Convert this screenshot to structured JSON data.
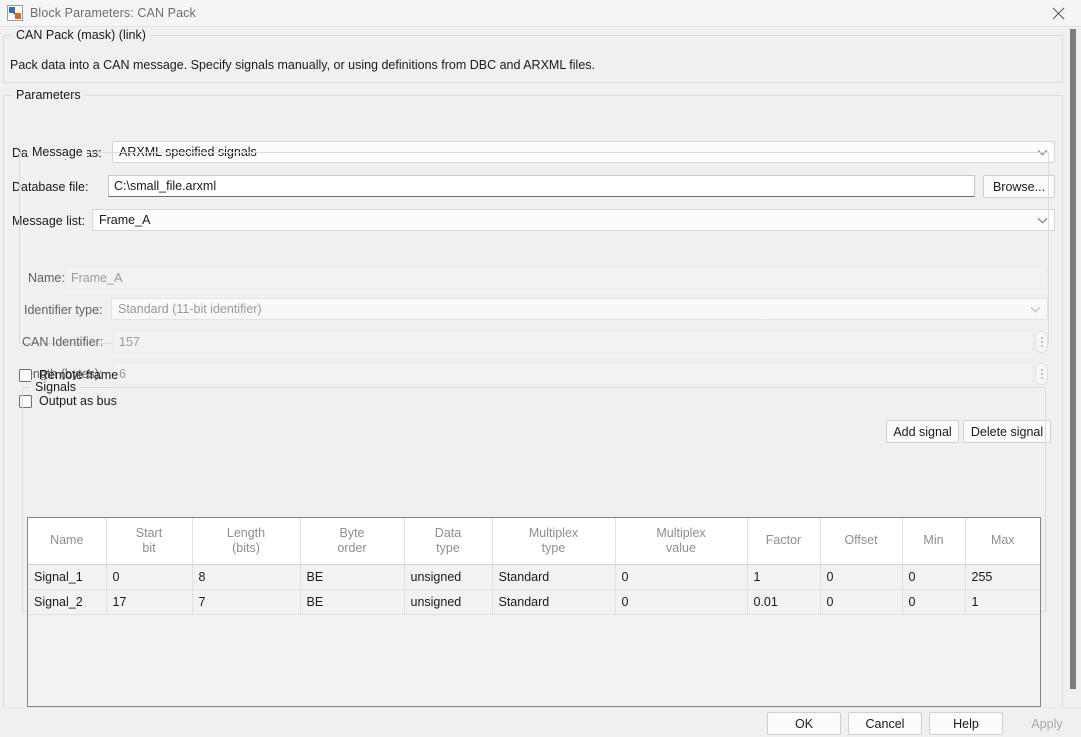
{
  "window": {
    "title": "Block Parameters: CAN Pack",
    "icon": "simulink-block-icon",
    "close_icon": "close-icon"
  },
  "description": {
    "legend": "CAN Pack (mask) (link)",
    "text": "Pack data into a CAN message. Specify signals manually, or using definitions from DBC and ARXML files."
  },
  "parameters": {
    "legend": "Parameters",
    "data_input_as": {
      "label": "Data is input as:",
      "value": "ARXML specified signals",
      "icon": "chevron-down-icon"
    },
    "database_file": {
      "label": "Database file:",
      "value": "C:\\small_file.arxml",
      "browse_label": "Browse..."
    },
    "message_list": {
      "label": "Message list:",
      "value": "Frame_A",
      "icon": "chevron-down-icon"
    }
  },
  "message": {
    "legend": "Message",
    "name": {
      "label": "Name:",
      "value": "Frame_A"
    },
    "identifier_type": {
      "label": "Identifier type:",
      "value": "Standard (11-bit identifier)",
      "icon": "chevron-down-icon"
    },
    "can_identifier": {
      "label": "CAN Identifier:",
      "value": "157",
      "spinner": "ellipsis-vertical-icon"
    },
    "length_bytes": {
      "label": "Length (bytes):",
      "value": "6",
      "spinner": "ellipsis-vertical-icon"
    },
    "remote_frame": {
      "label": "Remote frame",
      "checked": false
    },
    "output_as_bus": {
      "label": "Output as bus",
      "checked": false
    }
  },
  "signal_actions": {
    "add_label": "Add signal",
    "delete_label": "Delete signal"
  },
  "signals": {
    "legend": "Signals",
    "columns": [
      "Name",
      "Start\nbit",
      "Length\n(bits)",
      "Byte\norder",
      "Data\ntype",
      "Multiplex\ntype",
      "Multiplex\nvalue",
      "Factor",
      "Offset",
      "Min",
      "Max"
    ],
    "rows": [
      [
        "Signal_1",
        "0",
        "8",
        "BE",
        "unsigned",
        "Standard",
        "0",
        "1",
        "0",
        "0",
        "255"
      ],
      [
        "Signal_2",
        "17",
        "7",
        "BE",
        "unsigned",
        "Standard",
        "0",
        "0.01",
        "0",
        "0",
        "1"
      ]
    ]
  },
  "footer": {
    "ok": "OK",
    "cancel": "Cancel",
    "help": "Help",
    "apply": "Apply",
    "apply_disabled": true
  },
  "colors": {
    "window_bg": "#f0f0f0",
    "titlebar_bg": "#f5f5f5",
    "title_text": "#6d6d6d",
    "table_border": "#7e8596",
    "header_text": "#8e8e8e",
    "row_bg": "#f2f2f2",
    "scrollbar_thumb": "#7d7d7d",
    "disabled_text": "#9b9b9b"
  }
}
